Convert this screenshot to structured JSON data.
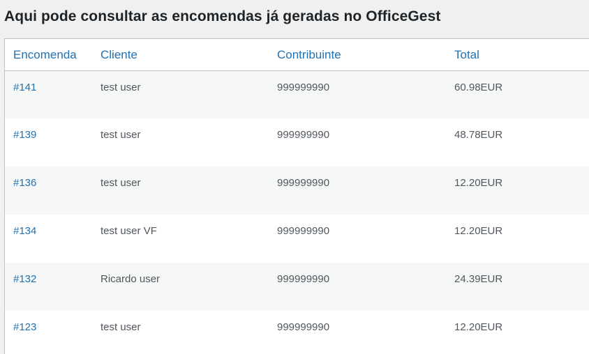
{
  "page": {
    "title": "Aqui pode consultar as encomendas já geradas no OfficeGest"
  },
  "table": {
    "columns": [
      "Encomenda",
      "Cliente",
      "Contribuinte",
      "Total"
    ],
    "rows": [
      {
        "order": "#141",
        "client": "test user",
        "taxpayer": "999999990",
        "total": "60.98EUR"
      },
      {
        "order": "#139",
        "client": "test user",
        "taxpayer": "999999990",
        "total": "48.78EUR"
      },
      {
        "order": "#136",
        "client": "test user",
        "taxpayer": "999999990",
        "total": "12.20EUR"
      },
      {
        "order": "#134",
        "client": "test user VF",
        "taxpayer": "999999990",
        "total": "12.20EUR"
      },
      {
        "order": "#132",
        "client": "Ricardo user",
        "taxpayer": "999999990",
        "total": "24.39EUR"
      },
      {
        "order": "#123",
        "client": "test user",
        "taxpayer": "999999990",
        "total": "12.20EUR"
      }
    ]
  },
  "colors": {
    "link": "#2271b1",
    "border": "#c3c4c7",
    "stripe": "#f6f7f7",
    "background": "#f0f0f1"
  }
}
